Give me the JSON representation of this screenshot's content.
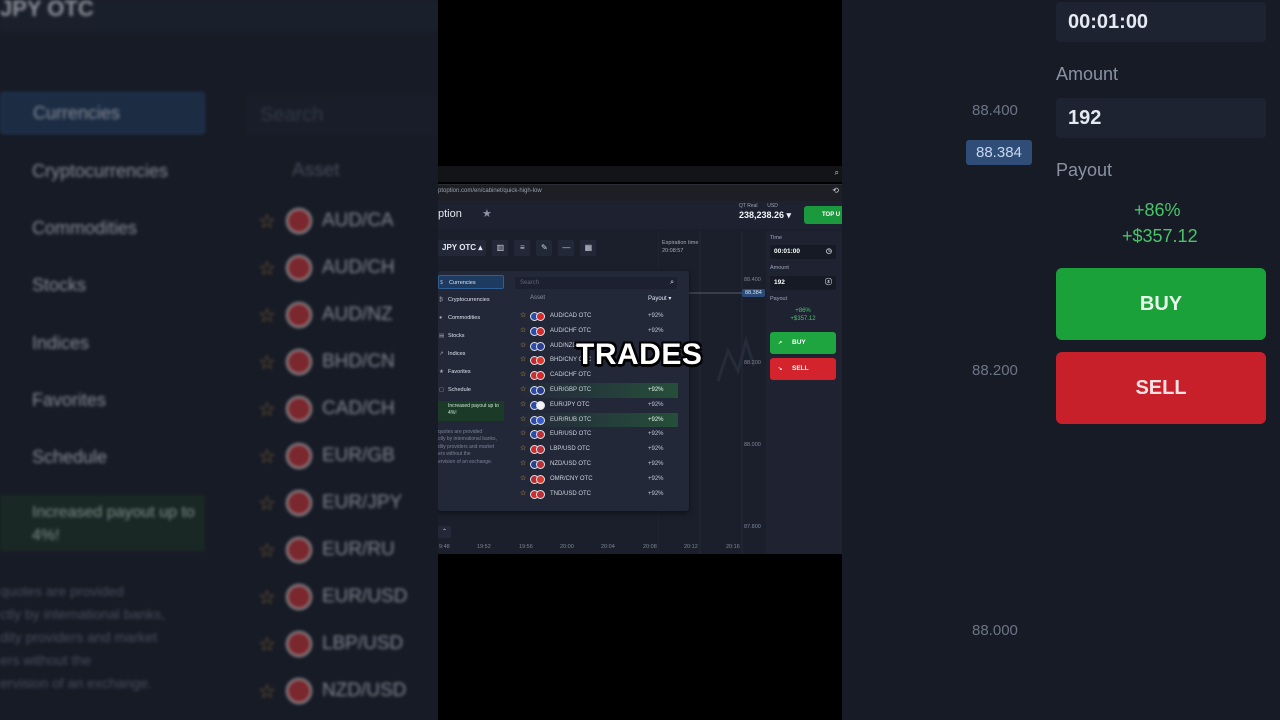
{
  "background": {
    "ticker": "JPY OTC",
    "categories": [
      "Currencies",
      "Cryptocurrencies",
      "Commodities",
      "Stocks",
      "Indices",
      "Favorites",
      "Schedule"
    ],
    "search_placeholder": "Search",
    "asset_header": "Asset",
    "assets": [
      "AUD/CA",
      "AUD/CH",
      "AUD/NZ",
      "BHD/CN",
      "CAD/CH",
      "EUR/GB",
      "EUR/JPY",
      "EUR/RU",
      "EUR/USD",
      "LBP/USD",
      "NZD/USD"
    ],
    "promo": "Increased payout up to 4%!",
    "note": "quotes are provided\nctly by international banks,\ndity providers and market\ners without the\nervision of an exchange.",
    "right": {
      "time_value": "00:01:00",
      "amount_label": "Amount",
      "amount_value": "192",
      "payout_label": "Payout",
      "payout_pct": "+86%",
      "payout_amount": "+$357.12",
      "buy": "BUY",
      "sell": "SELL"
    },
    "prices": [
      "88.400",
      "88.384",
      "88.200",
      "88.000"
    ]
  },
  "browser": {
    "url": "ptoption.com/en/cabinet/quick-high-low"
  },
  "app": {
    "logo": "ption",
    "balance_label_left": "QT Real",
    "balance_label_right": "USD",
    "balance": "238,238.26",
    "top_up": "TOP U",
    "pair": "JPY OTC",
    "expiration_label": "Expiration time",
    "expiration_value": "20:08:57",
    "chart_prices": [
      "88.400",
      "88.384",
      "88.200",
      "88.000",
      "87.800"
    ],
    "x_labels": [
      "9:48",
      "19:52",
      "19:56",
      "20:00",
      "20:04",
      "20:08",
      "20:12",
      "20:16"
    ],
    "right_panel": {
      "time_label": "Time",
      "time_value": "00:01:00",
      "amount_label": "Amount",
      "amount_value": "192",
      "payout_label": "Payout",
      "payout_pct": "+86%",
      "payout_amount": "+$357.12",
      "buy": "BUY",
      "sell": "SELL"
    },
    "dropdown": {
      "categories": [
        "Currencies",
        "Cryptocurrencies",
        "Commodities",
        "Stocks",
        "Indices",
        "Favorites",
        "Schedule"
      ],
      "promo": "Increased payout up to 4%!",
      "note": "quotes are provided\nctly by international banks,\ndity providers and market\ners without the\nervision of an exchange.",
      "search_placeholder": "Search",
      "col_asset": "Asset",
      "col_payout": "Payout",
      "rows": [
        {
          "name": "AUD/CAD OTC",
          "payout": "+92%",
          "hl": false,
          "c1": "#2a4aa8",
          "c2": "#d32a2a"
        },
        {
          "name": "AUD/CHF OTC",
          "payout": "+92%",
          "hl": false,
          "c1": "#2a4aa8",
          "c2": "#d32a2a"
        },
        {
          "name": "AUD/NZD OTC",
          "payout": "",
          "hl": false,
          "c1": "#2a4aa8",
          "c2": "#2a3f8f"
        },
        {
          "name": "BHD/CNY OTC",
          "payout": "",
          "hl": false,
          "c1": "#c4262e",
          "c2": "#d93a2a"
        },
        {
          "name": "CAD/CHF OTC",
          "payout": "",
          "hl": false,
          "c1": "#d32a2a",
          "c2": "#d32a2a"
        },
        {
          "name": "EUR/GBP OTC",
          "payout": "+92%",
          "hl": true,
          "c1": "#2a4aa8",
          "c2": "#2a3f8f"
        },
        {
          "name": "EUR/JPY OTC",
          "payout": "+92%",
          "hl": false,
          "c1": "#2a4aa8",
          "c2": "#f4f4f4"
        },
        {
          "name": "EUR/RUB OTC",
          "payout": "+92%",
          "hl": true,
          "c1": "#2a4aa8",
          "c2": "#3a5ac8"
        },
        {
          "name": "EUR/USD OTC",
          "payout": "+92%",
          "hl": false,
          "c1": "#2a4aa8",
          "c2": "#b8323a"
        },
        {
          "name": "LBP/USD OTC",
          "payout": "+92%",
          "hl": false,
          "c1": "#d32a2a",
          "c2": "#b8323a"
        },
        {
          "name": "NZD/USD OTC",
          "payout": "+92%",
          "hl": false,
          "c1": "#2a3f8f",
          "c2": "#b8323a"
        },
        {
          "name": "OMR/CNY OTC",
          "payout": "+92%",
          "hl": false,
          "c1": "#c4262e",
          "c2": "#d93a2a"
        },
        {
          "name": "TND/USD OTC",
          "payout": "+92%",
          "hl": false,
          "c1": "#d32a2a",
          "c2": "#b8323a"
        }
      ]
    }
  },
  "caption": "TRADES",
  "colors": {
    "buy": "#1fa53f",
    "sell": "#d3232c",
    "accent": "#2f5d95",
    "star": "#e8a73a"
  }
}
